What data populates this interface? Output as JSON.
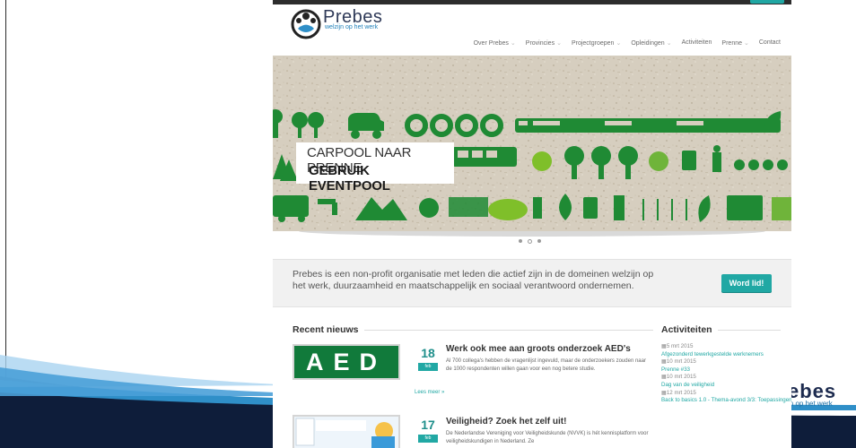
{
  "brand": {
    "name": "Prebes",
    "tagline": "welzijn op het werk",
    "echo_name": "ebes",
    "echo_tagline": "jn op het werk"
  },
  "nav": {
    "items": [
      {
        "label": "Over Prebes",
        "has_menu": true
      },
      {
        "label": "Provincies",
        "has_menu": true
      },
      {
        "label": "Projectgroepen",
        "has_menu": true
      },
      {
        "label": "Opleidingen",
        "has_menu": true
      },
      {
        "label": "Activiteiten",
        "has_menu": false
      },
      {
        "label": "Prenne",
        "has_menu": true
      },
      {
        "label": "Contact",
        "has_menu": false
      }
    ],
    "chevron": "⌄"
  },
  "hero": {
    "caption_line1": "CARPOOL NAAR PRENNE",
    "caption_line2": "GEBRUIK EVENTPOOL",
    "slides": 3,
    "active_slide": 2
  },
  "intro": {
    "text": "Prebes is een non-profit organisatie met leden die actief zijn in de domeinen welzijn op het werk, duurzaamheid en maatschappelijk en sociaal verantwoord ondernemen.",
    "cta_label": "Word lid!"
  },
  "news": {
    "heading": "Recent nieuws",
    "items": [
      {
        "day": "18",
        "month": "feb",
        "title": "Werk ook mee aan groots onderzoek AED's",
        "body": "Al 700 collega's hebben de vragenlijst ingevuld, maar de onderzoekers zouden naar de 1000 respondenten willen gaan voor een nog betere studie.",
        "more": "Lees meer »",
        "thumb_text": "AED"
      },
      {
        "day": "17",
        "month": "feb",
        "title": "Veiligheid? Zoek het zelf uit!",
        "body": "De Nederlandse Vereniging voor Veiligheidskunde (NVVK) is hét kennisplatform voor veiligheidskundigen in Nederland. Ze",
        "thumb_text": "Veiligheid? Zoek het zelf uit!"
      }
    ]
  },
  "activities": {
    "heading": "Activiteiten",
    "items": [
      {
        "date": "5 mrt 2015",
        "title": "Afgezonderd tewerkgestelde werknemers"
      },
      {
        "date": "10 mrt 2015",
        "title": "Prenne #33"
      },
      {
        "date": "10 mrt 2015",
        "title": "Dag van de veiligheid"
      },
      {
        "date": "12 mrt 2015",
        "title": "Back to basics 1.0 - Thema-avond 3/3: Toepassingen"
      }
    ]
  },
  "colors": {
    "accent": "#21a8a4",
    "hero_green": "#1f8a34",
    "topbar": "#2d2d2d",
    "slide_swoosh_blue": "#2f8fc8",
    "slide_swoosh_dark": "#0e1d3a"
  },
  "icons": [
    "logo-emblem",
    "calendar-icon",
    "tree-icon",
    "car-icon",
    "train-icon",
    "bus-icon",
    "wind-turbine-icon",
    "leaf-icon"
  ]
}
